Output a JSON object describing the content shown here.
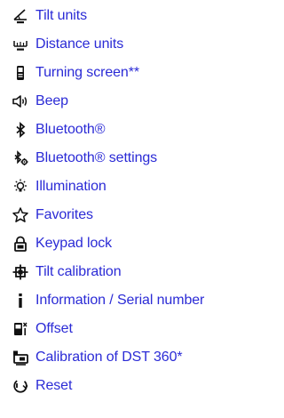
{
  "menu": {
    "link_color": "#2b2bd6",
    "icon_color": "#111111",
    "items": [
      {
        "icon": "tilt-units-icon",
        "label": "Tilt units"
      },
      {
        "icon": "distance-units-icon",
        "label": "Distance units"
      },
      {
        "icon": "turning-screen-icon",
        "label": "Turning screen**"
      },
      {
        "icon": "speaker-icon",
        "label": "Beep"
      },
      {
        "icon": "bluetooth-icon",
        "label": "Bluetooth®"
      },
      {
        "icon": "bluetooth-settings-icon",
        "label": "Bluetooth® settings"
      },
      {
        "icon": "illumination-icon",
        "label": "Illumination"
      },
      {
        "icon": "star-icon",
        "label": "Favorites"
      },
      {
        "icon": "padlock-icon",
        "label": "Keypad lock"
      },
      {
        "icon": "tilt-calibration-icon",
        "label": "Tilt calibration"
      },
      {
        "icon": "information-icon",
        "label": "Information / Serial number"
      },
      {
        "icon": "offset-icon",
        "label": "Offset"
      },
      {
        "icon": "dst-calibration-icon",
        "label": "Calibration of DST 360*"
      },
      {
        "icon": "reset-icon",
        "label": "Reset"
      }
    ]
  }
}
